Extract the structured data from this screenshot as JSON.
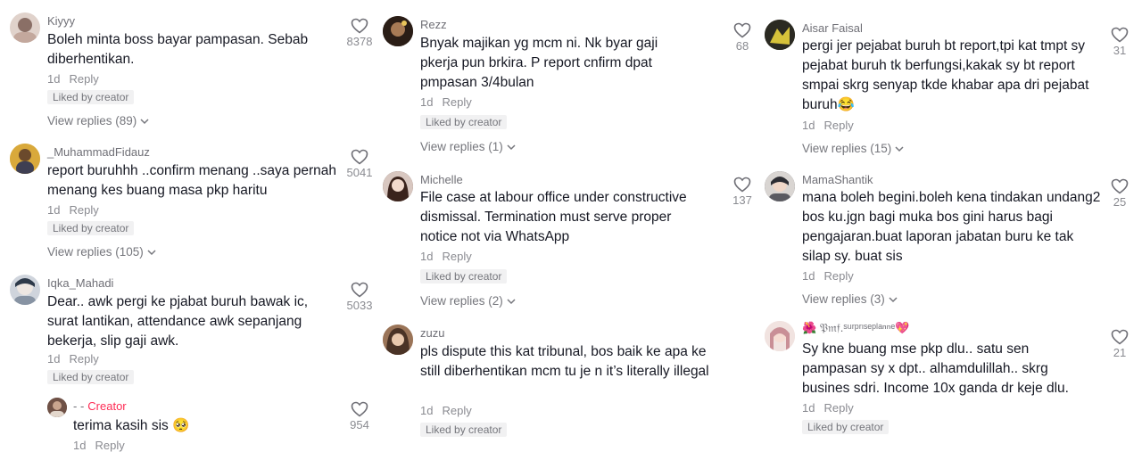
{
  "columns": [
    {
      "comments": [
        {
          "user": "Kiyyy",
          "text": "Boleh minta boss bayar pampasan. Sebab diberhentikan.",
          "time": "1d",
          "reply": "Reply",
          "badge": "Liked by creator",
          "replies": "View replies (89)",
          "likes": "8378",
          "avatar_color": "#d9c9c2"
        },
        {
          "user": "_MuhammadFidauz",
          "text": "report buruhhh ..confirm menang ..saya pernah menang kes buang masa pkp haritu",
          "time": "1d",
          "reply": "Reply",
          "badge": "Liked by creator",
          "replies": "View replies (105)",
          "likes": "5041",
          "avatar_color": "#e1b449"
        },
        {
          "user": "Iqka_Mahadi",
          "text": "Dear.. awk pergi ke pjabat buruh bawak ic, surat lantikan, attendance awk sepanjang bekerja, slip gaji awk.",
          "time": "1d",
          "reply": "Reply",
          "badge": "Liked by creator",
          "likes": "5033",
          "avatar_color": "#c9cfd8"
        },
        {
          "user": "- -",
          "creator": "Creator",
          "text": "terima kasih sis 🥺",
          "time": "1d",
          "reply": "Reply",
          "likes": "954",
          "avatar_color": "#7d6257"
        }
      ]
    },
    {
      "comments": [
        {
          "user": "Rezz",
          "text": "Bnyak majikan yg mcm ni. Nk byar gaji pkerja pun brkira. P report cnfirm dpat pmpasan 3/4bulan",
          "time": "1d",
          "reply": "Reply",
          "badge": "Liked by creator",
          "replies": "View replies (1)",
          "likes": "68",
          "avatar_color": "#3b2a20"
        },
        {
          "user": "Michelle",
          "text": "File case at labour office under constructive dismissal. Termination must serve proper notice not via WhatsApp",
          "time": "1d",
          "reply": "Reply",
          "badge": "Liked by creator",
          "replies": "View replies (2)",
          "likes": "137",
          "avatar_color": "#5a3b33"
        },
        {
          "user": "zuzu",
          "text": "pls dispute this kat tribunal, bos baik ke apa ke still diberhentikan mcm tu je n it’s literally illegal",
          "time": "1d",
          "reply": "Reply",
          "badge": "Liked by creator",
          "avatar_color": "#b98e6a"
        }
      ]
    },
    {
      "comments": [
        {
          "user": "Aisar Faisal",
          "text": "pergi jer pejabat buruh bt report,tpi kat tmpt sy pejabat buruh tk berfungsi,kakak sy bt report smpai skrg senyap tkde khabar apa dri pejabat buruh😂",
          "time": "1d",
          "reply": "Reply",
          "replies": "View replies (15)",
          "likes": "31",
          "avatar_color": "#2d2a1f"
        },
        {
          "user": "MamaShantik",
          "text": "mana boleh begini.boleh kena tindakan undang2 bos ku.jgn bagi muka bos gini harus bagi pengajaran.buat laporan jabatan buru ke tak silap sy. buat sis",
          "time": "1d",
          "reply": "Reply",
          "replies": "View replies (3)",
          "likes": "25",
          "avatar_color": "#4a4a4f"
        },
        {
          "user": "🌺 𝔓𝔪𝔣.ˢᵘʳᵖʳᶦˢᵉᵖˡᵃⁿⁿᵉ💖",
          "text": "Sy kne buang mse pkp dlu.. satu sen pampasan sy x dpt.. alhamdulillah.. skrg busines sdri. Income 10x ganda dr keje dlu.",
          "time": "1d",
          "reply": "Reply",
          "badge": "Liked by creator",
          "likes": "21",
          "avatar_color": "#ead8d4"
        }
      ]
    }
  ]
}
